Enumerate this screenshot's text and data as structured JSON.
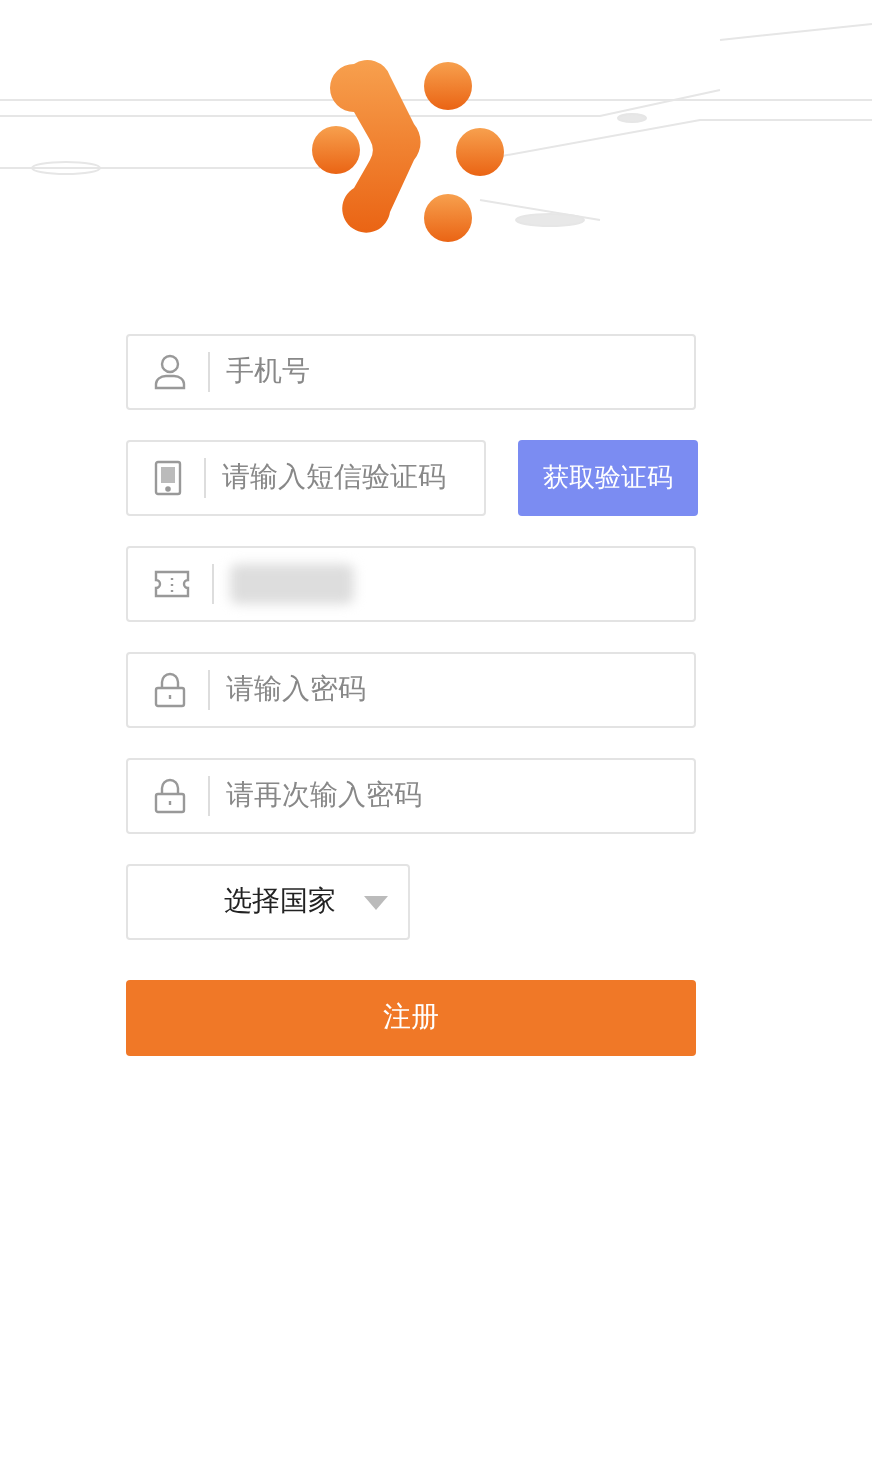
{
  "fields": [
    {
      "kind": "user",
      "placeholder": "手机号"
    },
    {
      "kind": "phone",
      "placeholder": "请输入短信验证码",
      "button": "获取验证码"
    },
    {
      "kind": "ticket",
      "blurred": true
    },
    {
      "kind": "lock",
      "placeholder": "请输入密码"
    },
    {
      "kind": "lock",
      "placeholder": "请再次输入密码"
    }
  ],
  "country_select": {
    "value": "选择国家"
  },
  "submit": "注册"
}
